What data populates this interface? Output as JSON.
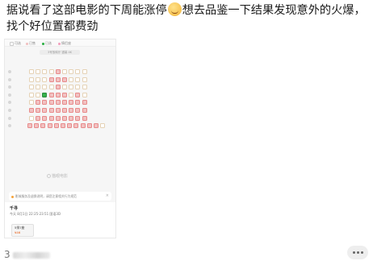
{
  "post": {
    "text_before_emoji": "据说看了这部电影的下周能涨停",
    "emoji": "smiling-face-emoji",
    "text_after_emoji": "想去品鉴一下结果发现意外的火爆，找个好位置都费劲"
  },
  "screenshot": {
    "legend": [
      "可选",
      "已售",
      "已选",
      "情侣座"
    ],
    "screen_label": "3号放映厅 银幕 4K",
    "watermark": "猫眼电影",
    "notice": "影城服务及退换说明，请您注意相关行为规范",
    "close_icon": "close-icon",
    "movie_title": "千寻",
    "show_time": "今天 8月1日 22:25-23:51 国语3D",
    "chip_seat": "5排7座",
    "chip_price": "¥46",
    "seat_colors": {
      "sold": "#f1c2c2",
      "available": "#ffffff",
      "selected": "#37b24d"
    },
    "seat_rows": [
      [
        "avail",
        "avail",
        "avail",
        "avail",
        "sold",
        "avail",
        "avail",
        "avail",
        "avail"
      ],
      [
        "avail",
        "avail",
        "avail",
        "sold",
        "sold",
        "sold",
        "avail",
        "avail",
        "avail"
      ],
      [
        "avail",
        "avail",
        "avail",
        "avail",
        "sold",
        "avail",
        "avail",
        "avail",
        "avail"
      ],
      [
        "avail",
        "avail",
        "sel",
        "sold",
        "sold",
        "sold",
        "avail",
        "sold",
        "avail"
      ],
      [
        "avail",
        "sold",
        "sold",
        "sold",
        "sold",
        "sold",
        "sold",
        "sold",
        "sold"
      ],
      [
        "sold",
        "sold",
        "sold",
        "sold",
        "sold",
        "sold",
        "sold",
        "sold",
        "sold"
      ],
      [
        "avail",
        "sold",
        "sold",
        "sold",
        "sold",
        "sold",
        "sold",
        "sold",
        "sold"
      ],
      [
        "sold",
        "sold",
        "sold",
        "sold",
        "sold",
        "sold",
        "sold",
        "sold",
        "sold",
        "sold",
        "sold",
        "avail"
      ]
    ]
  },
  "footer": {
    "count_prefix": "3",
    "more_icon": "more-dots-icon"
  }
}
